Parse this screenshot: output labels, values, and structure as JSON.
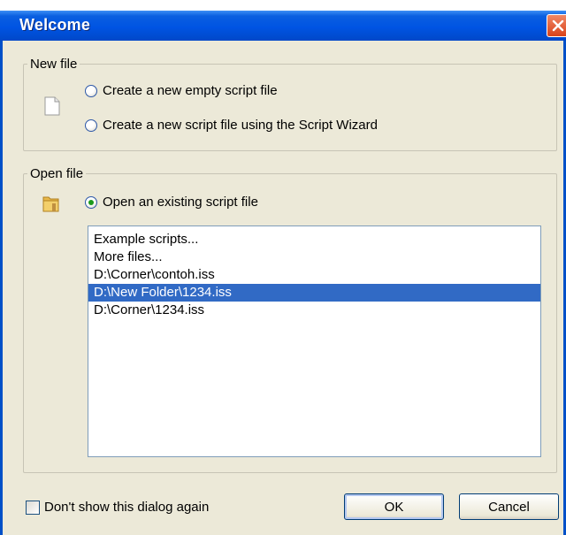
{
  "window": {
    "title": "Welcome"
  },
  "new_file": {
    "legend": "New file",
    "options": [
      {
        "label": "Create a new empty script file",
        "checked": false
      },
      {
        "label": "Create a new script file using the Script Wizard",
        "checked": false
      }
    ]
  },
  "open_file": {
    "legend": "Open file",
    "option": {
      "label": "Open an existing script file",
      "checked": true
    },
    "items": [
      {
        "label": "Example scripts..."
      },
      {
        "label": "More files..."
      },
      {
        "label": "D:\\Corner\\contoh.iss"
      },
      {
        "label": "D:\\New Folder\\1234.iss",
        "selected": true
      },
      {
        "label": "D:\\Corner\\1234.iss"
      }
    ]
  },
  "footer": {
    "dont_show_label": "Don't show this dialog again",
    "ok_label": "OK",
    "cancel_label": "Cancel"
  },
  "colors": {
    "titlebar": "#0054e3",
    "selection": "#316ac5",
    "dialog_bg": "#ece9d8"
  },
  "icons": {
    "close": "close-icon",
    "new_file": "file-icon",
    "open_file": "folder-icon"
  }
}
